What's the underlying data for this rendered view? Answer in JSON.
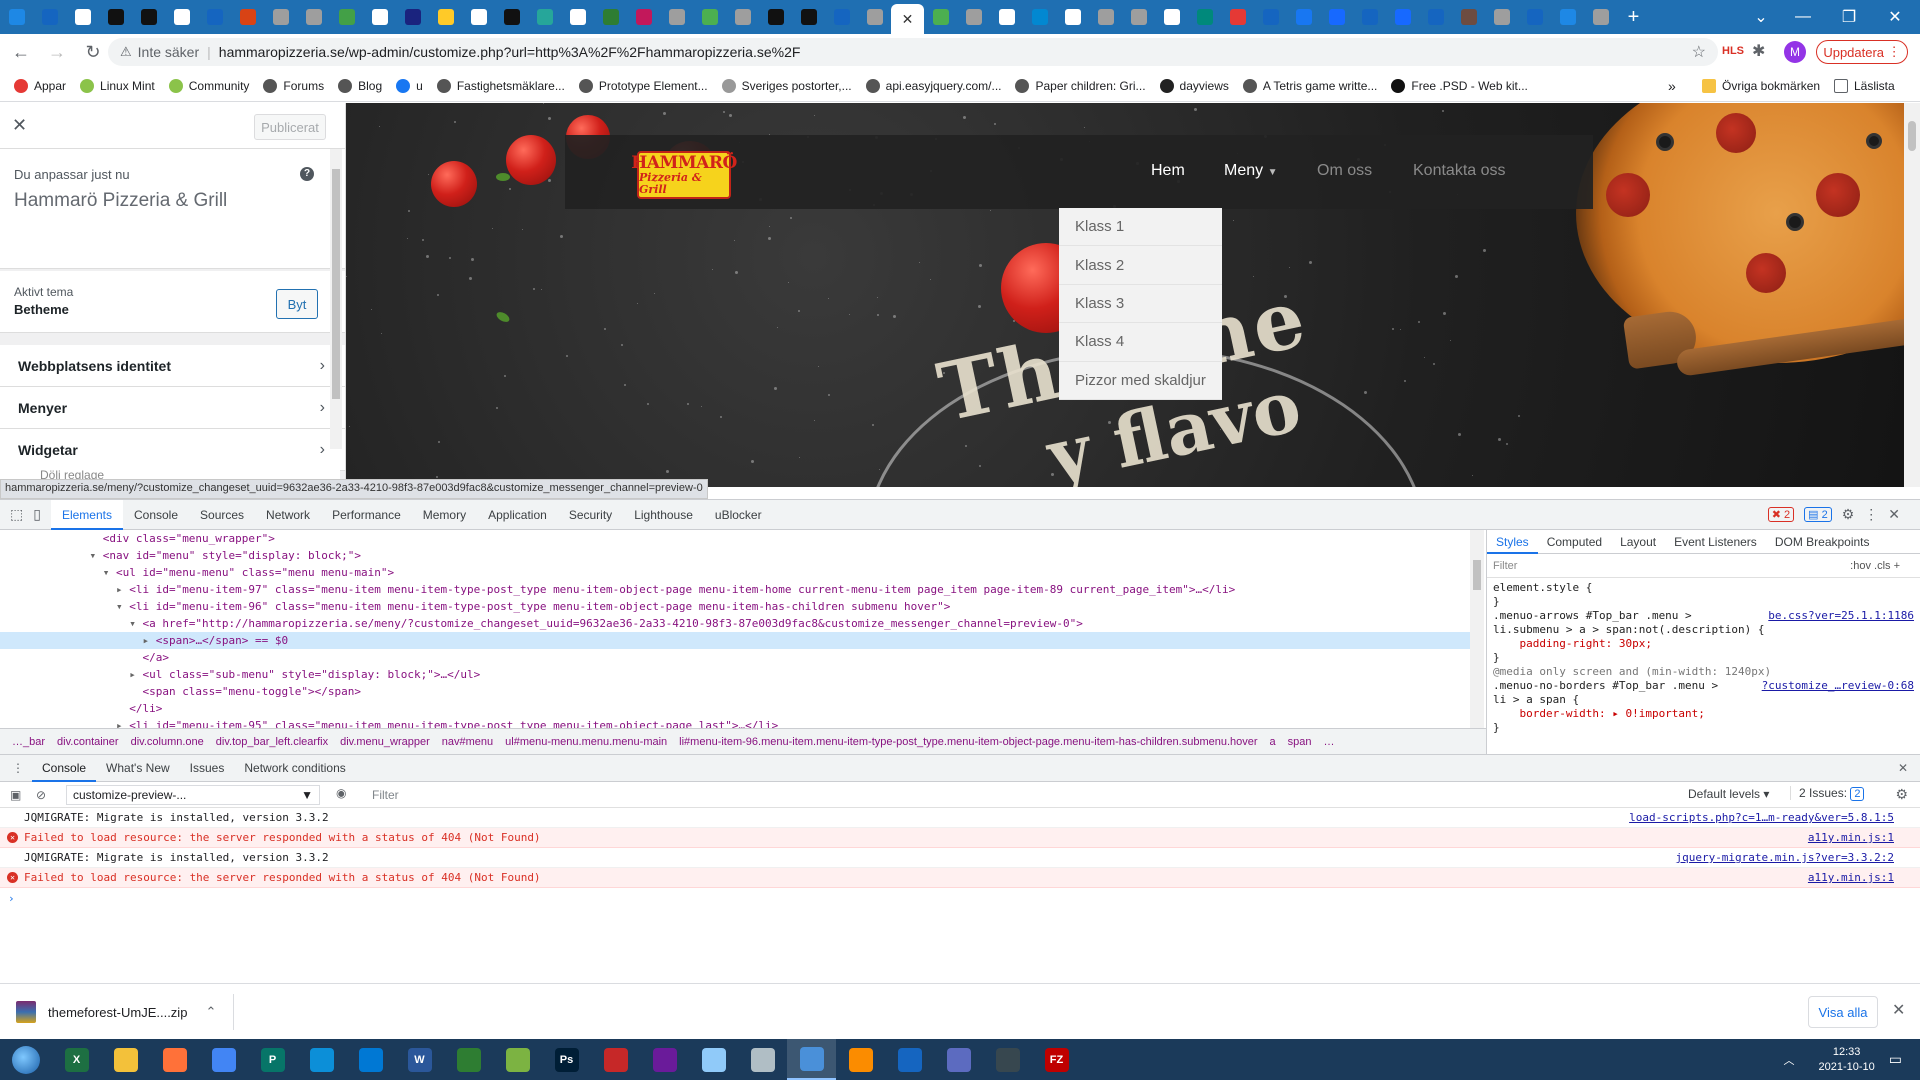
{
  "browser": {
    "tab_favicon_colors": [
      "#1e88e5",
      "#1565c0",
      "#ffffff",
      "#111111",
      "#111111",
      "#ffffff",
      "#1565c0",
      "#d84315",
      "#9e9e9e",
      "#9e9e9e",
      "#43a047",
      "#ffffff",
      "#1a237e",
      "#ffca28",
      "#ffffff",
      "#111111",
      "#26a69a",
      "#ffffff",
      "#2e7d32",
      "#c2185b",
      "#9e9e9e",
      "#4caf50",
      "#9e9e9e",
      "#111111",
      "#111111",
      "#1565c0",
      "#9e9e9e"
    ],
    "active_tab_close": "✕",
    "tab_favicon_colors_after": [
      "#4caf50",
      "#9e9e9e",
      "#ffffff",
      "#0288d1",
      "#ffffff",
      "#9e9e9e",
      "#9e9e9e",
      "#ffffff",
      "#00897b",
      "#e53935",
      "#1565c0",
      "#1877f2",
      "#1769ff",
      "#1565c0",
      "#1769ff",
      "#1565c0",
      "#6d4c41",
      "#9e9e9e",
      "#1565c0",
      "#1e88e5",
      "#9e9e9e"
    ],
    "new_tab": "+",
    "url_warning": "Inte säker",
    "url": "hammaropizzeria.se/wp-admin/customize.php?url=http%3A%2F%2Fhammaropizzeria.se%2F",
    "extension_label": "HLS",
    "profile_initial": "M",
    "update_button": "Uppdatera",
    "bookmarks": [
      {
        "label": "Appar",
        "color": "#e53935"
      },
      {
        "label": "Linux Mint",
        "color": "#8bc34a"
      },
      {
        "label": "Community",
        "color": "#8bc34a"
      },
      {
        "label": "Forums",
        "color": "#555555"
      },
      {
        "label": "Blog",
        "color": "#555555"
      },
      {
        "label": "u",
        "color": "#1877f2"
      },
      {
        "label": "Fastighetsmäklare...",
        "color": "#555555"
      },
      {
        "label": "Prototype Element...",
        "color": "#555555"
      },
      {
        "label": "Sveriges postorter,...",
        "color": "#999999"
      },
      {
        "label": "api.easyjquery.com/...",
        "color": "#555555"
      },
      {
        "label": "Paper children: Gri...",
        "color": "#555555"
      },
      {
        "label": "dayviews",
        "color": "#222222"
      },
      {
        "label": "A Tetris game writte...",
        "color": "#555555"
      },
      {
        "label": "Free .PSD - Web kit...",
        "color": "#111111"
      }
    ],
    "bookmarks_more": "»",
    "other_bookmarks": "Övriga bokmärken",
    "reading_list": "Läslista"
  },
  "customizer": {
    "publish_button": "Publicerat",
    "customizing_label": "Du anpassar just nu",
    "site_title": "Hammarö Pizzeria & Grill",
    "help_icon": "?",
    "active_theme_label": "Aktivt tema",
    "active_theme_name": "Betheme",
    "change_button": "Byt",
    "sections": [
      {
        "label": "Webbplatsens identitet"
      },
      {
        "label": "Menyer"
      },
      {
        "label": "Widgetar"
      }
    ],
    "footer_text": "Dölj reglage"
  },
  "preview": {
    "logo_line1": "HAMMARÖ",
    "logo_line2": "Pizzeria & Grill",
    "menu": {
      "home": "Hem",
      "menu": "Meny",
      "about": "Om oss",
      "contact": "Kontakta oss"
    },
    "submenu": [
      "Klass 1",
      "Klass 2",
      "Klass 3",
      "Klass 4",
      "Pizzor med skaldjur"
    ],
    "hero_text_1": "The one",
    "hero_text_2": "y flavo"
  },
  "status_url": "hammaropizzeria.se/meny/?customize_changeset_uuid=9632ae36-2a33-4210-98f3-87e003d9fac8&customize_messenger_channel=preview-0",
  "devtools": {
    "tabs": [
      "Elements",
      "Console",
      "Sources",
      "Network",
      "Performance",
      "Memory",
      "Application",
      "Security",
      "Lighthouse",
      "uBlocker"
    ],
    "active_tab": "Elements",
    "error_count": "2",
    "message_count": "2",
    "dom_lines": [
      {
        "indent": "              ",
        "html": "<div class=\"menu_wrapper\">"
      },
      {
        "indent": "            ▾ ",
        "html": "<nav id=\"menu\" style=\"display: block;\">"
      },
      {
        "indent": "              ▾ ",
        "html": "<ul id=\"menu-menu\" class=\"menu menu-main\">"
      },
      {
        "indent": "                ▸ ",
        "html": "<li id=\"menu-item-97\" class=\"menu-item menu-item-type-post_type menu-item-object-page menu-item-home current-menu-item page_item page-item-89 current_page_item\">…</li>"
      },
      {
        "indent": "                ▾ ",
        "html": "<li id=\"menu-item-96\" class=\"menu-item menu-item-type-post_type menu-item-object-page menu-item-has-children submenu hover\">"
      },
      {
        "indent": "                  ▾ ",
        "html": "<a href=\"http://hammaropizzeria.se/meny/?customize_changeset_uuid=9632ae36-2a33-4210-98f3-87e003d9fac8&customize_messenger_channel=preview-0\">"
      },
      {
        "indent": "                    ▸ ",
        "html": "<span>…</span> == $0"
      },
      {
        "indent": "                    ",
        "html": "</a>"
      },
      {
        "indent": "                  ▸ ",
        "html": "<ul class=\"sub-menu\" style=\"display: block;\">…</ul>"
      },
      {
        "indent": "                    ",
        "html": "<span class=\"menu-toggle\"></span>"
      },
      {
        "indent": "                  ",
        "html": "</li>"
      },
      {
        "indent": "                ▸ ",
        "html": "<li id=\"menu-item-95\" class=\"menu-item menu-item-type-post_type menu-item-object-page last\">…</li>"
      },
      {
        "indent": "                ▸ ",
        "html": "<li id=\"menu-item-93\" class=\"menu-item menu-item-type-post_type menu-item-object-page last\">…</li>"
      }
    ],
    "selected_line_index": 6,
    "styles_tabs": [
      "Styles",
      "Computed",
      "Layout",
      "Event Listeners",
      "DOM Breakpoints"
    ],
    "styles_filter_placeholder": "Filter",
    "styles_filter_right": ":hov  .cls  +",
    "css_rules": [
      {
        "text": "element.style {",
        "src": ""
      },
      {
        "text": "}",
        "src": ""
      },
      {
        "text": ".menuo-arrows #Top_bar .menu >",
        "src": "be.css?ver=25.1.1:1186"
      },
      {
        "text": "li.submenu > a > span:not(.description) {",
        "src": ""
      },
      {
        "text": "    padding-right: 30px;",
        "src": ""
      },
      {
        "text": "}",
        "src": ""
      },
      {
        "text": "@media only screen and (min-width: 1240px)",
        "src": ""
      },
      {
        "text": ".menuo-no-borders #Top_bar .menu >",
        "src": "?customize_…review-0:68"
      },
      {
        "text": "li > a span {",
        "src": ""
      },
      {
        "text": "    border-width: ▸ 0!important;",
        "src": ""
      },
      {
        "text": "}",
        "src": ""
      }
    ],
    "breadcrumbs": [
      "…_bar",
      "div.container",
      "div.column.one",
      "div.top_bar_left.clearfix",
      "div.menu_wrapper",
      "nav#menu",
      "ul#menu-menu.menu.menu-main",
      "li#menu-item-96.menu-item.menu-item-type-post_type.menu-item-object-page.menu-item-has-children.submenu.hover",
      "a",
      "span",
      "…"
    ],
    "drawer_tabs": [
      "Console",
      "What's New",
      "Issues",
      "Network conditions"
    ],
    "context_select": "customize-preview-...",
    "console_filter_placeholder": "Filter",
    "default_levels": "Default levels ▾",
    "issues_label": "2 Issues: ",
    "issues_count": "2",
    "console_lines": [
      {
        "type": "log",
        "text": "JQMIGRATE: Migrate is installed, version 3.3.2",
        "src": "load-scripts.php?c=1…m-ready&ver=5.8.1:5"
      },
      {
        "type": "error",
        "text": "Failed to load resource: the server responded with a status of 404 (Not Found)",
        "src": "a11y.min.js:1"
      },
      {
        "type": "log",
        "text": "JQMIGRATE: Migrate is installed, version 3.3.2",
        "src": "jquery-migrate.min.js?ver=3.3.2:2"
      },
      {
        "type": "error",
        "text": "Failed to load resource: the server responded with a status of 404 (Not Found)",
        "src": "a11y.min.js:1"
      }
    ],
    "prompt": "›"
  },
  "download": {
    "filename": "themeforest-UmJE....zip",
    "show_all": "Visa alla"
  },
  "taskbar": {
    "apps": [
      {
        "name": "excel",
        "color": "#1d6f42",
        "glyph": "X"
      },
      {
        "name": "file-explorer",
        "color": "#f3c13a",
        "glyph": ""
      },
      {
        "name": "firefox",
        "color": "#ff7139",
        "glyph": ""
      },
      {
        "name": "chrome",
        "color": "#4285f4",
        "glyph": ""
      },
      {
        "name": "publisher",
        "color": "#077568",
        "glyph": "P"
      },
      {
        "name": "edge",
        "color": "#0c8fd8",
        "glyph": ""
      },
      {
        "name": "mail",
        "color": "#0078d4",
        "glyph": ""
      },
      {
        "name": "word",
        "color": "#2b579a",
        "glyph": "W"
      },
      {
        "name": "notepad-green",
        "color": "#2e7d32",
        "glyph": ""
      },
      {
        "name": "cloud",
        "color": "#7cb342",
        "glyph": ""
      },
      {
        "name": "photoshop",
        "color": "#001e36",
        "glyph": "Ps"
      },
      {
        "name": "pdf",
        "color": "#c62828",
        "glyph": ""
      },
      {
        "name": "app-purple",
        "color": "#6a1b9a",
        "glyph": ""
      },
      {
        "name": "app-blue",
        "color": "#90caf9",
        "glyph": ""
      },
      {
        "name": "app-gray",
        "color": "#b0bec5",
        "glyph": ""
      },
      {
        "name": "app-window",
        "color": "#4a90d9",
        "glyph": ""
      },
      {
        "name": "app-orange",
        "color": "#fb8c00",
        "glyph": ""
      },
      {
        "name": "app-image",
        "color": "#1565c0",
        "glyph": ""
      },
      {
        "name": "app-triangle",
        "color": "#5c6bc0",
        "glyph": ""
      },
      {
        "name": "app-flag",
        "color": "#37474f",
        "glyph": ""
      },
      {
        "name": "filezilla",
        "color": "#bf0000",
        "glyph": "FZ"
      }
    ],
    "time": "12:33",
    "date": "2021-10-10"
  }
}
